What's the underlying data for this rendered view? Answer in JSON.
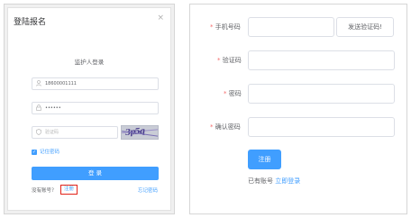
{
  "login_dialog": {
    "title": "登陆报名",
    "close_glyph": "×",
    "subtitle": "监护人登录",
    "username_value": "18600001111",
    "password_value": "••••••",
    "captcha_placeholder": "验证码",
    "captcha_image_text": "3p5q",
    "remember_label": "记住密码",
    "login_button": "登 录",
    "no_account_text": "没有账号？",
    "register_link": "注册",
    "forgot_link": "忘记密码",
    "icons": {
      "user": "user-icon",
      "lock": "lock-icon",
      "shield": "shield-icon",
      "check": "checkbox-checked-icon"
    }
  },
  "register_form": {
    "phone_label": "手机号码",
    "send_code_button": "发送验证码!",
    "code_label": "验证码",
    "password_label": "密码",
    "confirm_password_label": "确认密码",
    "required_mark": "*",
    "register_button": "注册",
    "has_account_text": "已有账号",
    "login_link": "立即登录"
  },
  "colors": {
    "primary": "#409eff",
    "required": "#f56c6c",
    "highlight_border": "#e2231a"
  }
}
